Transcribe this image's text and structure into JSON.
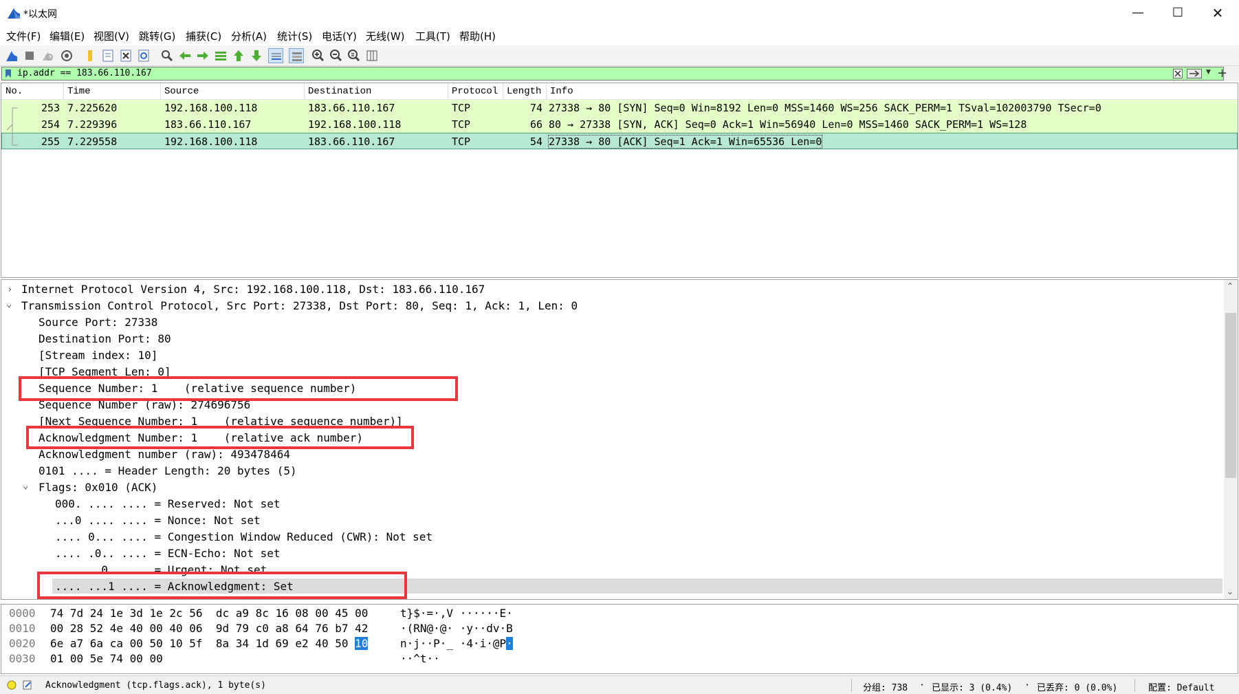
{
  "window": {
    "title": "*以太网",
    "minimize": "—",
    "maximize": "☐",
    "close": "✕"
  },
  "menu": [
    "文件(F)",
    "编辑(E)",
    "视图(V)",
    "跳转(G)",
    "捕获(C)",
    "分析(A)",
    "统计(S)",
    "电话(Y)",
    "无线(W)",
    "工具(T)",
    "帮助(H)"
  ],
  "filter": {
    "value": "ip.addr == 183.66.110.167",
    "add_label": "+"
  },
  "packet_list": {
    "columns": [
      "No.",
      "Time",
      "Source",
      "Destination",
      "Protocol",
      "Length",
      "Info"
    ],
    "rows": [
      {
        "no": "253",
        "time": "7.225620",
        "src": "192.168.100.118",
        "dst": "183.66.110.167",
        "proto": "TCP",
        "len": "74",
        "info": "27338 → 80 [SYN] Seq=0 Win=8192 Len=0 MSS=1460 WS=256 SACK_PERM=1 TSval=102003790 TSecr=0"
      },
      {
        "no": "254",
        "time": "7.229396",
        "src": "183.66.110.167",
        "dst": "192.168.100.118",
        "proto": "TCP",
        "len": "66",
        "info": "80 → 27338 [SYN, ACK] Seq=0 Ack=1 Win=56940 Len=0 MSS=1460 SACK_PERM=1 WS=128"
      },
      {
        "no": "255",
        "time": "7.229558",
        "src": "192.168.100.118",
        "dst": "183.66.110.167",
        "proto": "TCP",
        "len": "54",
        "info": "27338 → 80 [ACK] Seq=1 Ack=1 Win=65536 Len=0"
      }
    ]
  },
  "details": [
    "Internet Protocol Version 4, Src: 192.168.100.118, Dst: 183.66.110.167",
    "Transmission Control Protocol, Src Port: 27338, Dst Port: 80, Seq: 1, Ack: 1, Len: 0",
    "Source Port: 27338",
    "Destination Port: 80",
    "[Stream index: 10]",
    "[TCP Segment Len: 0]",
    "Sequence Number: 1    (relative sequence number)",
    "Sequence Number (raw): 274696756",
    "[Next Sequence Number: 1    (relative sequence number)]",
    "Acknowledgment Number: 1    (relative ack number)",
    "Acknowledgment number (raw): 493478464",
    "0101 .... = Header Length: 20 bytes (5)",
    "Flags: 0x010 (ACK)",
    "000. .... .... = Reserved: Not set",
    "...0 .... .... = Nonce: Not set",
    ".... 0... .... = Congestion Window Reduced (CWR): Not set",
    ".... .0.. .... = ECN-Echo: Not set",
    ".... ..0. .... = Urgent: Not set",
    ".... ...1 .... = Acknowledgment: Set"
  ],
  "hex": [
    {
      "off": "0000",
      "bytes": "74 7d 24 1e 3d 1e 2c 56  dc a9 8c 16 08 00 45 00",
      "ascii": "t}$·=·,V ······E·"
    },
    {
      "off": "0010",
      "bytes": "00 28 52 4e 40 00 40 06  9d 79 c0 a8 64 76 b7 42",
      "ascii": "·(RN@·@· ·y··dv·B"
    },
    {
      "off": "0020",
      "bytes_pre": "6e a7 6a ca 00 50 10 5f  8a 34 1d 69 e2 40 50 ",
      "bytes_hl": "10",
      "ascii_pre": "n·j··P·_ ·4·i·@P",
      "ascii_hl": "·"
    },
    {
      "off": "0030",
      "bytes": "01 00 5e 74 00 00",
      "ascii": "··^t··"
    }
  ],
  "status": {
    "field": "Acknowledgment (tcp.flags.ack), 1 byte(s)",
    "packets": "分组: 738",
    "displayed": "已显示: 3 (0.4%)",
    "dropped": "已丢弃: 0 (0.0%)",
    "profile": "配置: Default"
  },
  "colors": {
    "filter_valid": "#afffaf",
    "row_tcp": "#e4ffc7",
    "row_selected": "#b6e8d3",
    "highlight_box": "#e8383d",
    "hex_highlight": "#1e7fde"
  }
}
